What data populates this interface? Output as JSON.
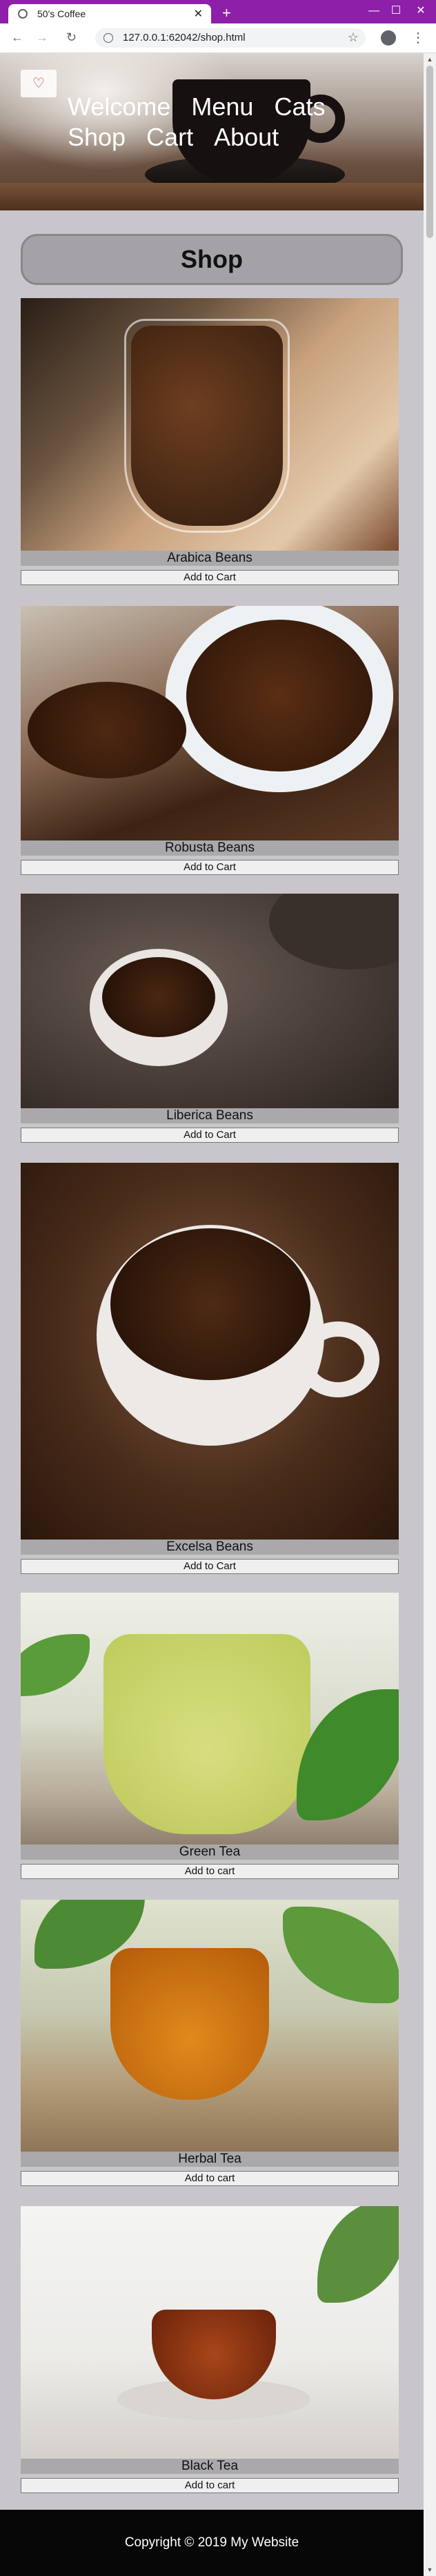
{
  "browser": {
    "tab_title": "50's Coffee",
    "tab_close_glyph": "✕",
    "new_tab_glyph": "+",
    "url": "127.0.0.1:62042/shop.html",
    "icons": [
      "favicon-icon",
      "close-icon",
      "new-tab-icon",
      "minimize-icon",
      "maximize-icon",
      "window-close-icon",
      "back-icon",
      "forward-icon",
      "reload-icon",
      "info-icon",
      "star-icon",
      "account-icon",
      "menu-icon"
    ]
  },
  "header": {
    "logo_glyph": "♡",
    "nav": [
      "Welcome",
      "Menu",
      "Cats",
      "Shop",
      "Cart",
      "About"
    ]
  },
  "shop": {
    "title": "Shop",
    "products": [
      {
        "name": "Arabica Beans",
        "button": "Add to Cart"
      },
      {
        "name": "Robusta Beans",
        "button": "Add to Cart"
      },
      {
        "name": "Liberica Beans",
        "button": "Add to Cart"
      },
      {
        "name": "Excelsa Beans",
        "button": "Add to Cart"
      },
      {
        "name": "Green Tea",
        "button": "Add to cart"
      },
      {
        "name": "Herbal Tea",
        "button": "Add to cart"
      },
      {
        "name": "Black Tea",
        "button": "Add to cart"
      }
    ]
  },
  "footer": {
    "text": "Copyright © 2019 My Website"
  },
  "colors": {
    "browser_frame": "#8e1fa8",
    "page_background": "#c9c6cb",
    "footer_background": "#070707"
  }
}
